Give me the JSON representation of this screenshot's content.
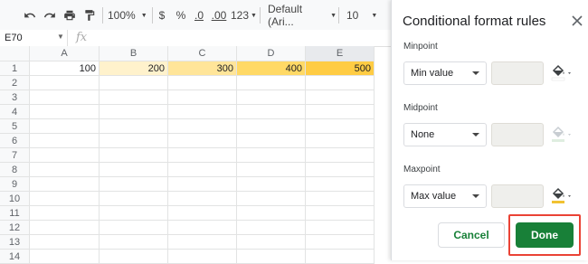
{
  "toolbar": {
    "zoom": "100%",
    "currency": "$",
    "percent": "%",
    "dec_decrease": ".0",
    "dec_increase": ".00",
    "more_formats": "123",
    "font": "Default (Ari...",
    "font_size": "10"
  },
  "formula_bar": {
    "cell_ref": "E70",
    "fx": "fx"
  },
  "columns": [
    "A",
    "B",
    "C",
    "D",
    "E"
  ],
  "rows": [
    "1",
    "2",
    "3",
    "4",
    "5",
    "6",
    "7",
    "8",
    "9",
    "10",
    "11",
    "12",
    "13",
    "14"
  ],
  "row1_values": [
    "100",
    "200",
    "300",
    "400",
    "500"
  ],
  "row1_colors": [
    "#ffffff",
    "#fff2cc",
    "#ffe599",
    "#ffd966",
    "#ffcc44"
  ],
  "panel": {
    "title": "Conditional format rules",
    "minpoint": {
      "label": "Minpoint",
      "select": "Min value"
    },
    "midpoint": {
      "label": "Midpoint",
      "select": "None"
    },
    "maxpoint": {
      "label": "Maxpoint",
      "select": "Max value"
    },
    "min_color": "#ffffff",
    "max_color": "#f1c232",
    "cancel": "Cancel",
    "done": "Done"
  }
}
